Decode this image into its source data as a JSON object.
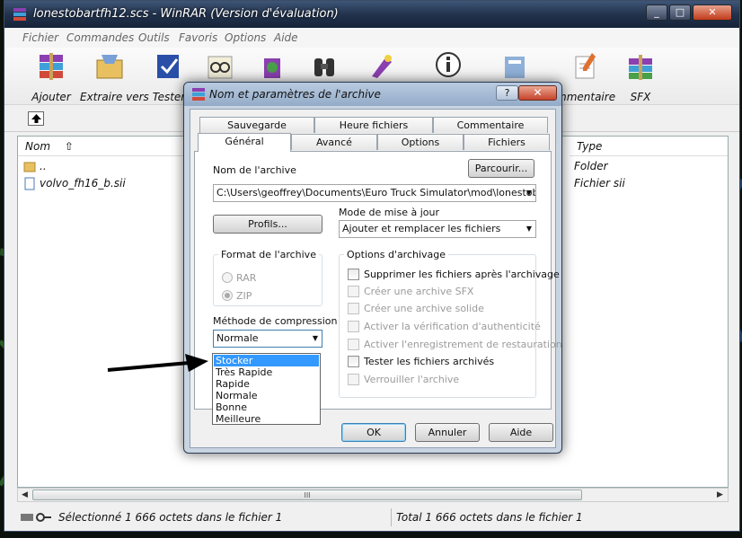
{
  "window": {
    "title": "lonestobartfh12.scs - WinRAR (Version d'évaluation)",
    "controls": {
      "minimize": "_",
      "maximize": "□",
      "close": "✕"
    }
  },
  "menu": [
    "Fichier",
    "Commandes",
    "Outils",
    "Favoris",
    "Options",
    "Aide"
  ],
  "toolbar": {
    "add": "Ajouter",
    "extract": "Extraire vers",
    "test": "Tester",
    "comment": "mmentaire",
    "sfx": "SFX"
  },
  "list": {
    "columns": {
      "name": "Nom",
      "type": "Type"
    },
    "rows": [
      {
        "name": "..",
        "type": "Folder",
        "icon": "folder-icon"
      },
      {
        "name": "volvo_fh16_b.sii",
        "type": "Fichier sii",
        "icon": "document-icon"
      }
    ],
    "scroll_grip": "III"
  },
  "status": {
    "left": "Sélectionné 1 666 octets dans le fichier 1",
    "right": "Total 1 666 octets dans le fichier 1"
  },
  "dialog": {
    "title": "Nom et paramètres de l'archive",
    "help": "?",
    "close": "✕",
    "tabs_back": [
      "Sauvegarde",
      "Heure fichiers",
      "Commentaire"
    ],
    "tabs_front": [
      "Général",
      "Avancé",
      "Options",
      "Fichiers"
    ],
    "active_tab": "Général",
    "archive_name_label": "Nom de l'archive",
    "browse_button": "Parcourir...",
    "archive_path": "C:\\Users\\geoffrey\\Documents\\Euro Truck Simulator\\mod\\lonestobartfh",
    "profiles_button": "Profils...",
    "update_mode_label": "Mode de mise à jour",
    "update_mode_value": "Ajouter et remplacer les fichiers",
    "format_group": "Format de l'archive",
    "format_rar": "RAR",
    "format_zip": "ZIP",
    "format_selected": "ZIP",
    "options_group": "Options d'archivage",
    "options": [
      {
        "label": "Supprimer les fichiers après l'archivage",
        "enabled": true,
        "checked": false
      },
      {
        "label": "Créer une archive SFX",
        "enabled": false,
        "checked": false
      },
      {
        "label": "Créer une archive solide",
        "enabled": false,
        "checked": false
      },
      {
        "label": "Activer la vérification d'authenticité",
        "enabled": false,
        "checked": false
      },
      {
        "label": "Activer l'enregistrement de restauration",
        "enabled": false,
        "checked": false
      },
      {
        "label": "Tester les fichiers archivés",
        "enabled": true,
        "checked": false
      },
      {
        "label": "Verrouiller l'archive",
        "enabled": false,
        "checked": false
      }
    ],
    "compression_label": "Méthode de compression",
    "compression_value": "Normale",
    "compression_options": [
      "Stocker",
      "Très Rapide",
      "Rapide",
      "Normale",
      "Bonne",
      "Meilleure"
    ],
    "compression_highlighted": "Stocker",
    "ok_button": "OK",
    "cancel_button": "Annuler",
    "help_button": "Aide"
  },
  "colors": {
    "titlebar": "#22334d",
    "dialog_frame": "#c9d4e1",
    "highlight": "#3399ff",
    "annotation_arrow": "#000000"
  }
}
